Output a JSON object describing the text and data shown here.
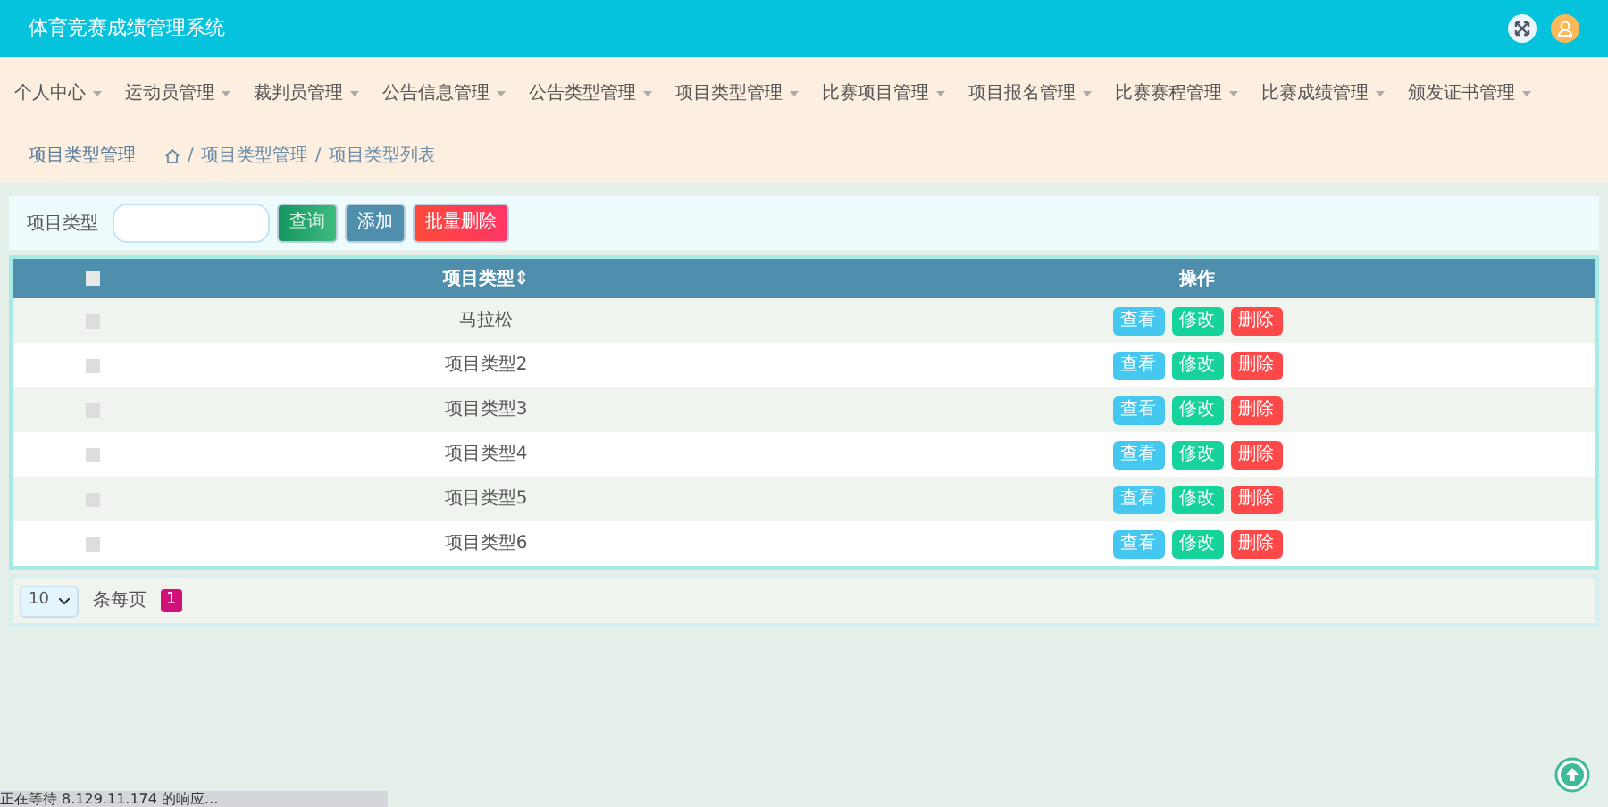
{
  "header": {
    "title": "体育竞赛成绩管理系统"
  },
  "menu": [
    {
      "label": "个人中心"
    },
    {
      "label": "运动员管理"
    },
    {
      "label": "裁判员管理"
    },
    {
      "label": "公告信息管理"
    },
    {
      "label": "公告类型管理"
    },
    {
      "label": "项目类型管理"
    },
    {
      "label": "比赛项目管理"
    },
    {
      "label": "项目报名管理"
    },
    {
      "label": "比赛赛程管理"
    },
    {
      "label": "比赛成绩管理"
    },
    {
      "label": "颁发证书管理"
    }
  ],
  "breadcrumb": {
    "title": "项目类型管理",
    "separator": "/",
    "path": [
      "项目类型管理",
      "项目类型列表"
    ]
  },
  "search": {
    "label": "项目类型",
    "search_button": "查询",
    "add_button": "添加",
    "batch_delete_button": "批量删除"
  },
  "table": {
    "all_checked": false,
    "columns": [
      "项目类型",
      "操作"
    ],
    "sort_mark": "⇕",
    "rows": [
      {
        "checked": false,
        "name": "马拉松",
        "actions": [
          "查看",
          "修改",
          "删除"
        ]
      },
      {
        "checked": false,
        "name": "项目类型2",
        "actions": [
          "查看",
          "修改",
          "删除"
        ]
      },
      {
        "checked": false,
        "name": "项目类型3",
        "actions": [
          "查看",
          "修改",
          "删除"
        ]
      },
      {
        "checked": false,
        "name": "项目类型4",
        "actions": [
          "查看",
          "修改",
          "删除"
        ]
      },
      {
        "checked": false,
        "name": "项目类型5",
        "actions": [
          "查看",
          "修改",
          "删除"
        ]
      },
      {
        "checked": false,
        "name": "项目类型6",
        "actions": [
          "查看",
          "修改",
          "删除"
        ]
      }
    ]
  },
  "pagination": {
    "page_size": "10",
    "label": "条每页",
    "pages": [
      {
        "label": "1",
        "selected": true
      }
    ]
  },
  "status_bar": "正在等待 8.129.11.174 的响应..."
}
